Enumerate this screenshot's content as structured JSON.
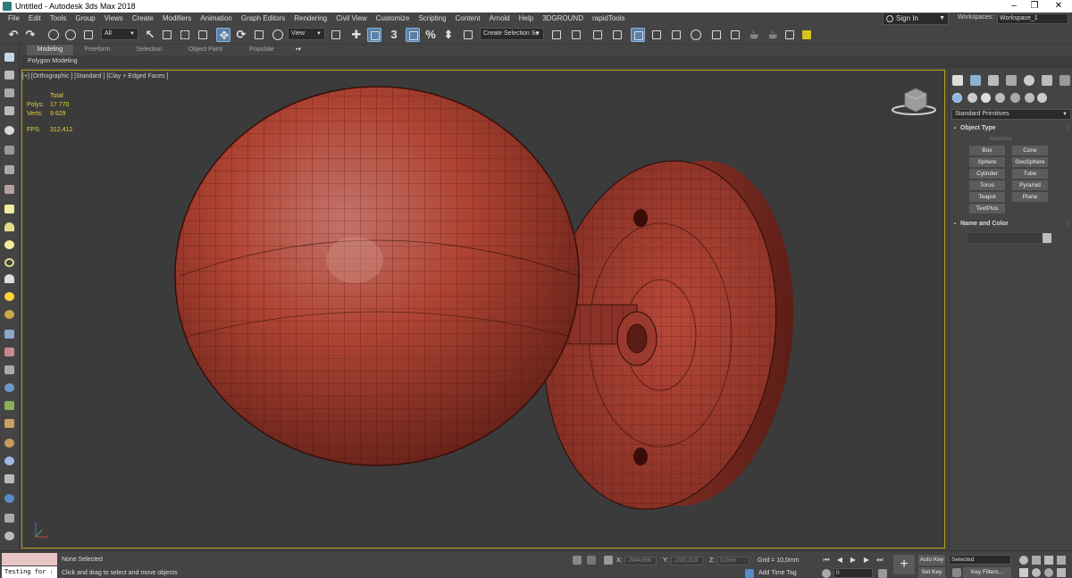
{
  "window": {
    "title": "Untitled - Autodesk 3ds Max 2018",
    "minimize": "–",
    "maximize": "❐",
    "close": "✕"
  },
  "menu": [
    "File",
    "Edit",
    "Tools",
    "Group",
    "Views",
    "Create",
    "Modifiers",
    "Animation",
    "Graph Editors",
    "Rendering",
    "Civil View",
    "Customize",
    "Scripting",
    "Content",
    "Arnold",
    "Help",
    "3DGROUND",
    "rapidTools"
  ],
  "signin": "Sign In",
  "workspaces": {
    "label": "Workspaces:",
    "value": "Workspace_1"
  },
  "toolbar": {
    "filter_dropdown": "All",
    "refcoord_dropdown": "View",
    "snap_label": "3",
    "percent_label": "%",
    "spinner_label": "⬍",
    "selection_set": "Create Selection Se"
  },
  "ribbon": {
    "tabs": [
      "Modeling",
      "Freeform",
      "Selection",
      "Object Paint",
      "Populate"
    ],
    "active_tab": "Modeling",
    "panel_label": "Polygon Modeling"
  },
  "viewport": {
    "label": "[+] [Orthographic ] [Standard ] [Clay + Edged Faces ]",
    "stats_header": "Total",
    "polys_label": "Polys:",
    "polys_value": "17 770",
    "verts_label": "Verts:",
    "verts_value": "9 629",
    "fps_label": "FPS:",
    "fps_value": "312,412"
  },
  "command_panel": {
    "category": "Standard Primitives",
    "object_type_title": "Object Type",
    "autogrid": "AutoGrid",
    "primitives": [
      "Box",
      "Cone",
      "Sphere",
      "GeoSphere",
      "Cylinder",
      "Tube",
      "Torus",
      "Pyramid",
      "Teapot",
      "Plane",
      "TextPlus"
    ],
    "name_color_title": "Name and Color"
  },
  "statusbar": {
    "maxscript": "Testing for :",
    "selection_status": "None Selected",
    "prompt": "Click and drag to select and move objects",
    "x_label": "X:",
    "x_value": "-2944,698",
    "y_label": "Y:",
    "y_value": "-1001,813",
    "z_label": "Z:",
    "z_value": "0,0mm",
    "grid": "Grid = 10,0mm",
    "add_time_tag": "Add Time Tag",
    "auto_key": "Auto Key",
    "set_key": "Set Key",
    "selected": "Selected",
    "key_filters": "Key Filters...",
    "frame": "0"
  },
  "colors": {
    "viewport_bg": "#3b3b3b",
    "active_border": "#b8a21a",
    "object_red": "#b04434",
    "stats_yellow": "#e8d23a"
  }
}
